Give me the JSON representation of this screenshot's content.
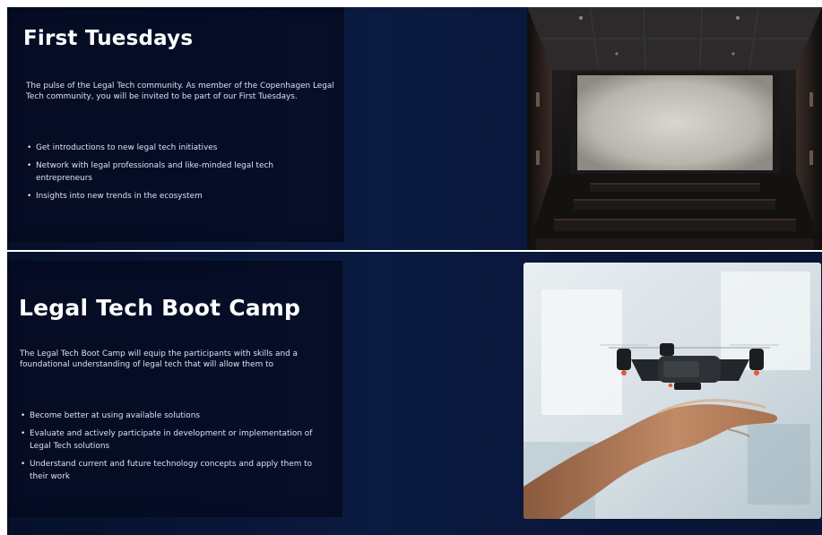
{
  "sections": [
    {
      "title": "First Tuesdays",
      "description": "The pulse of the Legal Tech community. As member of the Copenhagen Legal Tech community, you will be invited to be part of our First Tuesdays.",
      "bullets": [
        "Get introductions to new legal tech initiatives",
        "Network with legal professionals and like-minded legal tech entrepreneurs",
        "Insights into new trends in the ecosystem"
      ],
      "image_icon": "cinema-screen-photo"
    },
    {
      "title": "Legal Tech Boot Camp",
      "description": "The Legal Tech Boot Camp will equip the participants with skills and a foundational understanding of legal tech that will allow them to",
      "bullets": [
        "Become better at using available solutions",
        "Evaluate and actively participate in development or implementation of Legal Tech solutions",
        "Understand current and future technology concepts and apply them to their work"
      ],
      "image_icon": "drone-over-hand-photo"
    }
  ],
  "bullet_glyph": "•",
  "colors": {
    "background": "#081635",
    "panel": "#050c22",
    "text": "#dbe2f1",
    "title": "#ffffff"
  }
}
